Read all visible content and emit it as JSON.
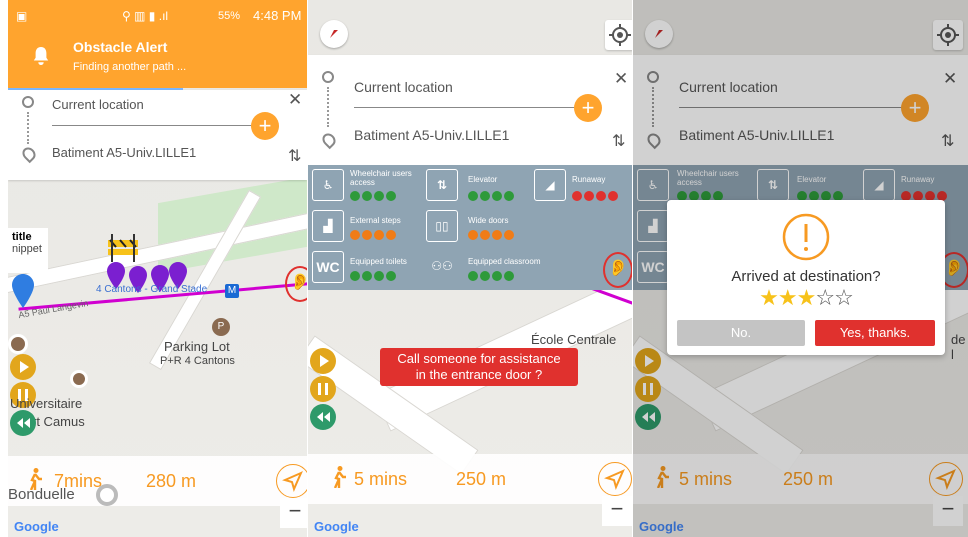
{
  "status_bar": {
    "signal_percent": "55%",
    "time": "4:48 PM"
  },
  "alert": {
    "title": "Obstacle Alert",
    "subtitle": "Finding another path ..."
  },
  "route": {
    "from": "Current location",
    "to": "Batiment A5-Univ.LILLE1"
  },
  "map_labels": {
    "tooltip_title": "title",
    "tooltip_snippet": "nippet",
    "station": "4 Cantons - Grand Stade",
    "street": "A5 Paul Langevin",
    "parking": "Parking Lot",
    "parking_sub": "P+R 4 Cantons",
    "univ_line1": "Universitaire",
    "univ_line2": "rt Camus",
    "bonduelle": "Bonduelle",
    "ecole": "École Centrale de",
    "ecole_short": "de l"
  },
  "trip1": {
    "time": "7mins",
    "distance": "280 m"
  },
  "trip2": {
    "time": "5 mins",
    "distance": "250 m"
  },
  "trip3": {
    "time": "5 mins",
    "distance": "250 m"
  },
  "google": "Google",
  "accessibility": [
    {
      "label": "Wheelchair users access",
      "icon": "wheelchair-icon",
      "dots": [
        "g",
        "g",
        "g",
        "g"
      ]
    },
    {
      "label": "Elevator",
      "icon": "elevator-icon",
      "dots": [
        "g",
        "g",
        "g",
        "g"
      ]
    },
    {
      "label": "Runaway",
      "icon": "ramp-icon",
      "dots": [
        "r",
        "r",
        "r",
        "r"
      ]
    },
    {
      "label": "External steps",
      "icon": "steps-icon",
      "dots": [
        "o",
        "o",
        "o",
        "o"
      ]
    },
    {
      "label": "Wide doors",
      "icon": "wide-doors-icon",
      "dots": [
        "o",
        "o",
        "o",
        "o"
      ]
    },
    {
      "label": "Equipped toilets",
      "icon": "toilets-icon",
      "glyph": "WC",
      "dots": [
        "g",
        "g",
        "g",
        "g"
      ]
    },
    {
      "label": "Equipped classroom",
      "icon": "classroom-icon",
      "dots": [
        "g",
        "g",
        "g",
        "g"
      ]
    }
  ],
  "assist_prompt": {
    "line1": "Call someone for assistance",
    "line2": "in the entrance door ?"
  },
  "dialog": {
    "question": "Arrived at destination?",
    "rating": 3,
    "rating_max": 5,
    "no_label": "No.",
    "yes_label": "Yes, thanks."
  },
  "colors": {
    "accent": "#ffa42e",
    "danger": "#e0312e",
    "green": "#2e9a3a",
    "orange": "#f07c17",
    "access_panel": "#8fa4b3"
  }
}
